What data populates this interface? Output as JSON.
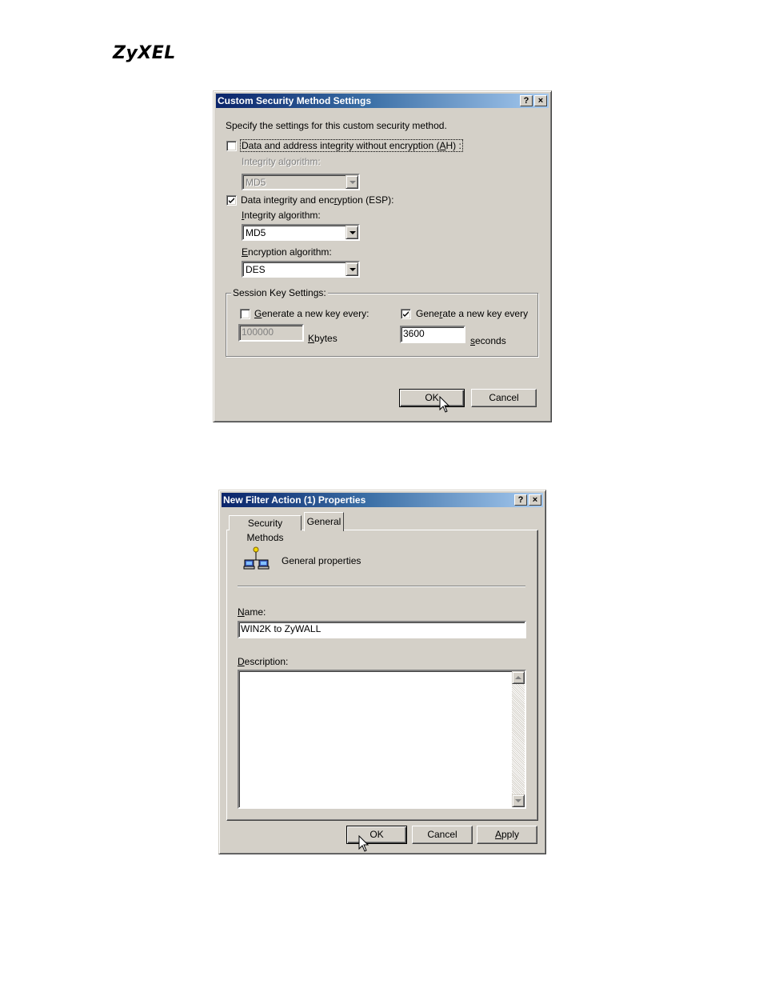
{
  "brand": {
    "logo_text": "ZyXEL"
  },
  "dialog1": {
    "title": "Custom Security Method Settings",
    "help_button": "?",
    "close_button": "×",
    "instruction": "Specify the settings for this custom security method.",
    "ah": {
      "label_pre": "Data and address integrity without encryption (",
      "label_key": "A",
      "label_post": "H) :",
      "checked": false,
      "integrity_label": "Integrity algorithm:",
      "integrity_value": "MD5"
    },
    "esp": {
      "label_pre": "Data integrity and enc",
      "label_key": "r",
      "label_post": "yption (ESP):",
      "checked": true,
      "integrity_label_key": "I",
      "integrity_label_rest": "ntegrity algorithm:",
      "integrity_value": "MD5",
      "encryption_label_key": "E",
      "encryption_label_rest": "ncryption algorithm:",
      "encryption_value": "DES"
    },
    "session": {
      "legend": "Session Key Settings:",
      "kb_key": "G",
      "kb_rest": "enerate a new key every:",
      "kb_checked": false,
      "kb_value": "100000",
      "kb_unit_key": "K",
      "kb_unit_rest": "bytes",
      "sec_pre": "Gene",
      "sec_key": "r",
      "sec_post": "ate a new key every",
      "sec_checked": true,
      "sec_value": "3600",
      "sec_unit_key": "s",
      "sec_unit_rest": "econds"
    },
    "ok_label": "OK",
    "cancel_label": "Cancel"
  },
  "dialog2": {
    "title": "New Filter Action (1) Properties",
    "help_button": "?",
    "close_button": "×",
    "tabs": [
      "Security Methods",
      "General"
    ],
    "active_tab": "General",
    "heading": "General properties",
    "name_label_key": "N",
    "name_label_rest": "ame:",
    "name_value": "WIN2K to ZyWALL",
    "description_label_key": "D",
    "description_label_rest": "escription:",
    "description_value": "",
    "ok_label": "OK",
    "cancel_label": "Cancel",
    "apply_label_key": "A",
    "apply_label_rest": "pply"
  }
}
